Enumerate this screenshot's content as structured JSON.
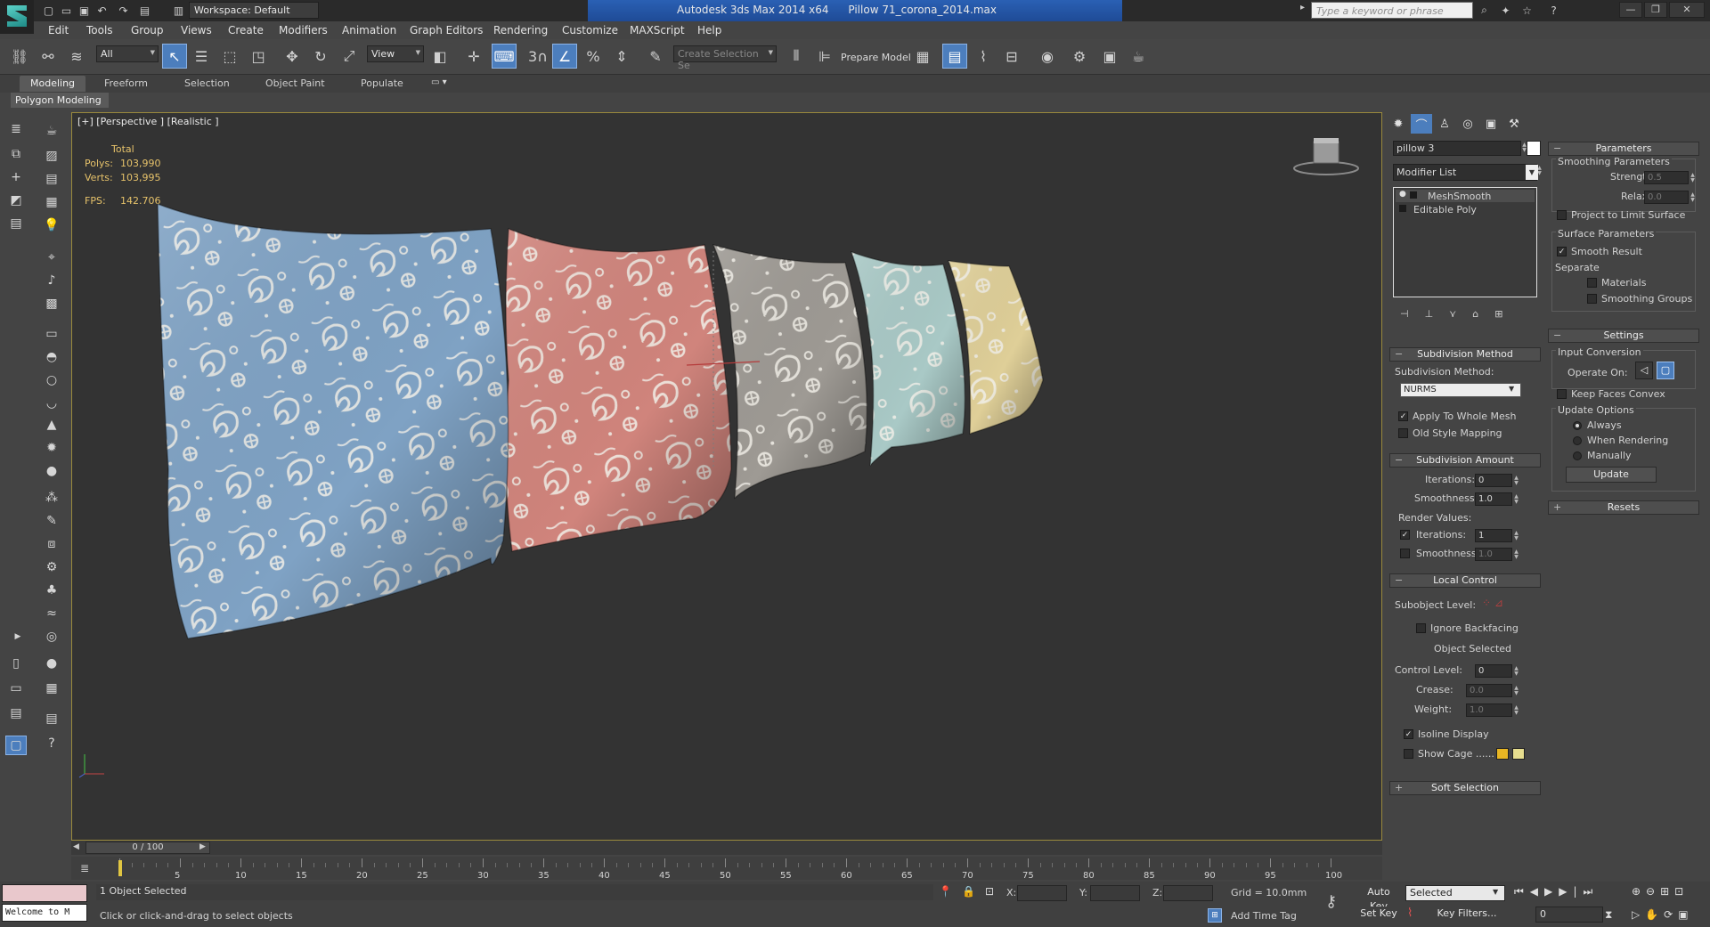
{
  "title_bar": {
    "workspace": "Workspace: Default",
    "app_title": "Autodesk 3ds Max  2014 x64",
    "file_name": "Pillow 71_corona_2014.max",
    "search_placeholder": "Type a keyword or phrase"
  },
  "menu": [
    "Edit",
    "Tools",
    "Group",
    "Views",
    "Create",
    "Modifiers",
    "Animation",
    "Graph Editors",
    "Rendering",
    "Customize",
    "MAXScript",
    "Help"
  ],
  "toolbar": {
    "selection_filter": "All",
    "ref_coord": "View",
    "angle_snap": "3",
    "named_selection_placeholder": "Create Selection Se",
    "prepare_model": "Prepare Model"
  },
  "ribbon": {
    "tabs": [
      "Modeling",
      "Freeform",
      "Selection",
      "Object Paint",
      "Populate"
    ],
    "panel": "Polygon Modeling"
  },
  "viewport": {
    "label": "[+] [Perspective ] [Realistic ]",
    "stats": {
      "total_label": "Total",
      "polys_label": "Polys:",
      "polys": "103,990",
      "verts_label": "Verts:",
      "verts": "103,995",
      "fps_label": "FPS:",
      "fps": "142.706"
    },
    "pillow_colors": [
      "#7fa2c4",
      "#d0847c",
      "#9e9a94",
      "#a9c9c6",
      "#dfcf98"
    ]
  },
  "command_panel": {
    "object_name": "pillow 3",
    "modifier_list": "Modifier List",
    "stack": [
      "MeshSmooth",
      "Editable Poly"
    ],
    "subdivision_method": {
      "title": "Subdivision Method",
      "label": "Subdivision Method:",
      "value": "NURMS",
      "apply_whole_mesh": "Apply To Whole Mesh",
      "old_style_mapping": "Old Style Mapping"
    },
    "subdivision_amount": {
      "title": "Subdivision Amount",
      "iterations_label": "Iterations:",
      "iterations": "0",
      "smoothness_label": "Smoothness:",
      "smoothness": "1.0",
      "render_values": "Render Values:",
      "render_iterations_label": "Iterations:",
      "render_iterations": "1",
      "render_smoothness_label": "Smoothness:",
      "render_smoothness": "1.0"
    },
    "local_control": {
      "title": "Local Control",
      "subobject_level": "Subobject Level:",
      "ignore_backfacing": "Ignore Backfacing",
      "object_selected": "Object Selected",
      "control_level_label": "Control Level:",
      "control_level": "0",
      "crease_label": "Crease:",
      "crease": "0.0",
      "weight_label": "Weight:",
      "weight": "1.0",
      "isoline_display": "Isoline Display",
      "show_cage": "Show Cage ......"
    },
    "soft_selection": "Soft Selection",
    "parameters": {
      "title": "Parameters",
      "smoothing_params": "Smoothing Parameters",
      "strength_label": "Strength:",
      "strength": "0.5",
      "relax_label": "Relax:",
      "relax": "0.0",
      "project_limit": "Project to Limit Surface",
      "surface_params": "Surface Parameters",
      "smooth_result": "Smooth Result",
      "separate": "Separate",
      "materials": "Materials",
      "smoothing_groups": "Smoothing Groups"
    },
    "settings": {
      "title": "Settings",
      "input_conversion": "Input Conversion",
      "operate_on": "Operate On:",
      "keep_faces_convex": "Keep Faces Convex",
      "update_options": "Update Options",
      "always": "Always",
      "when_rendering": "When Rendering",
      "manually": "Manually",
      "update": "Update"
    },
    "resets": "Resets"
  },
  "timeline": {
    "slider": "0 / 100",
    "ticks": [
      "0",
      "5",
      "10",
      "15",
      "20",
      "25",
      "30",
      "35",
      "40",
      "45",
      "50",
      "55",
      "60",
      "65",
      "70",
      "75",
      "80",
      "85",
      "90",
      "95",
      "100"
    ]
  },
  "status": {
    "welcome": "Welcome to M",
    "selection": "1 Object Selected",
    "prompt": "Click or click-and-drag to select objects",
    "x_label": "X:",
    "y_label": "Y:",
    "z_label": "Z:",
    "grid": "Grid = 10.0mm",
    "add_time_tag": "Add Time Tag",
    "auto_key": "Auto Key",
    "set_key": "Set Key",
    "selected": "Selected",
    "key_filters": "Key Filters...",
    "frame": "0"
  }
}
